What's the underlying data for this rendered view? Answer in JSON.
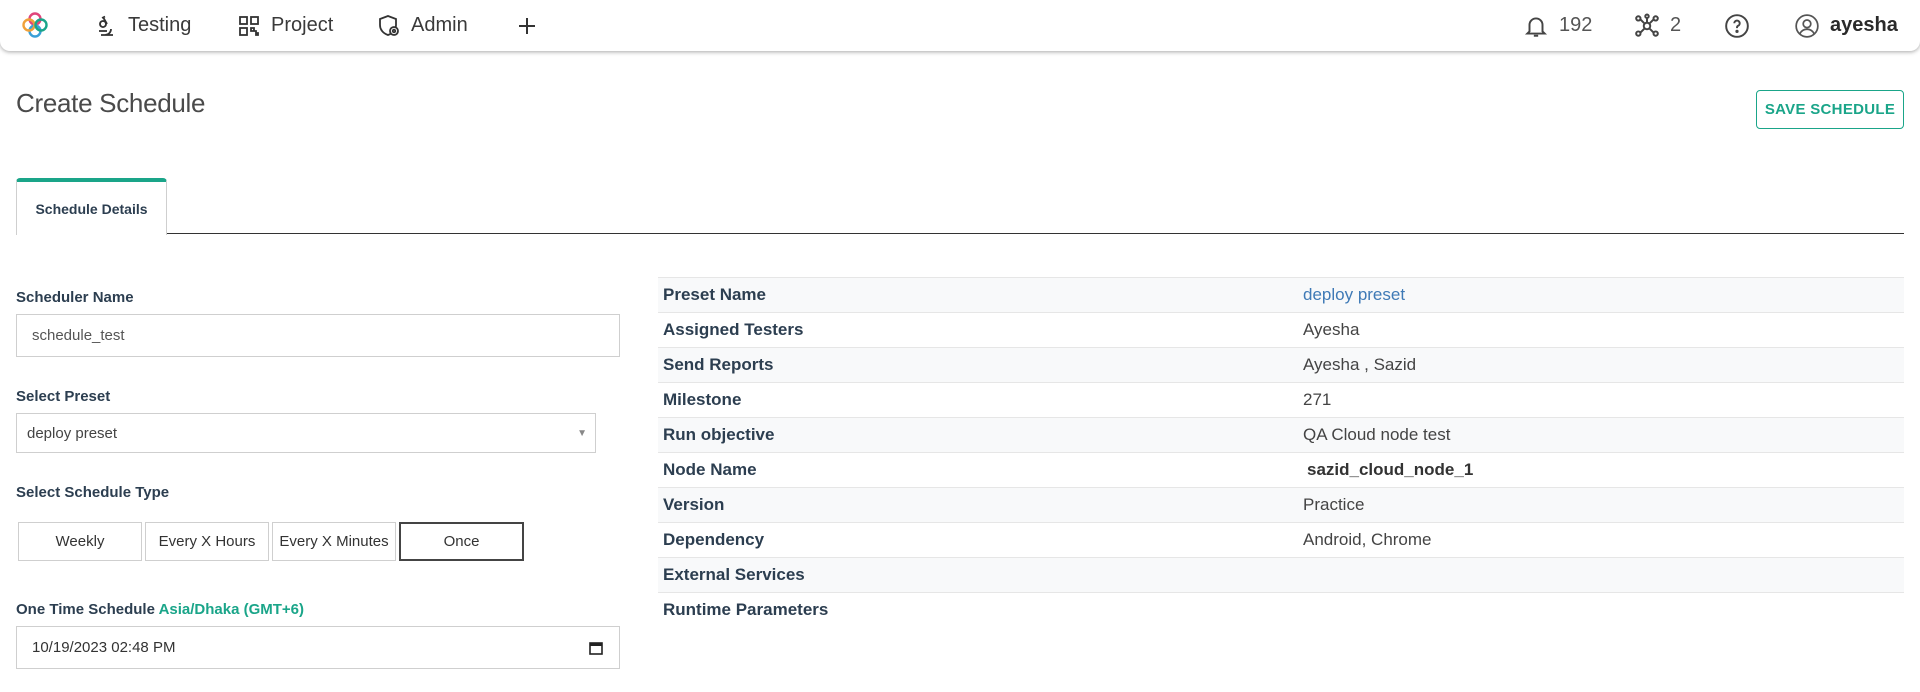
{
  "nav": {
    "items": [
      {
        "label": "Testing",
        "icon": "microscope-icon"
      },
      {
        "label": "Project",
        "icon": "qr-grid-icon"
      },
      {
        "label": "Admin",
        "icon": "shield-gear-icon"
      }
    ],
    "add_icon": "plus-icon",
    "notifications_count": "192",
    "nodes_count": "2",
    "username": "ayesha"
  },
  "page": {
    "title": "Create Schedule",
    "save_label": "SAVE SCHEDULE"
  },
  "tabs": [
    {
      "label": "Schedule Details",
      "active": true
    }
  ],
  "form": {
    "scheduler_name_label": "Scheduler Name",
    "scheduler_name_value": "schedule_test",
    "preset_label": "Select Preset",
    "preset_value": "deploy preset",
    "schedule_type_label": "Select Schedule Type",
    "schedule_types": [
      "Weekly",
      "Every X Hours",
      "Every X Minutes",
      "Once"
    ],
    "schedule_type_selected": "Once",
    "one_time_label": "One Time Schedule",
    "timezone": "Asia/Dhaka (GMT+6)",
    "datetime_value": "10/19/2023  02:48  PM"
  },
  "details": [
    {
      "key": "Preset Name",
      "value": "deploy preset"
    },
    {
      "key": "Assigned Testers",
      "value": "Ayesha"
    },
    {
      "key": "Send Reports",
      "value": "Ayesha , Sazid"
    },
    {
      "key": "Milestone",
      "value": "271"
    },
    {
      "key": "Run objective",
      "value": "QA Cloud node test"
    },
    {
      "key": "Node Name",
      "value": "sazid_cloud_node_1"
    },
    {
      "key": "Version",
      "value": "Practice"
    },
    {
      "key": "Dependency",
      "value": "Android, Chrome"
    },
    {
      "key": "External Services",
      "value": ""
    },
    {
      "key": "Runtime Parameters",
      "value": ""
    }
  ],
  "colors": {
    "accent": "#1aa589",
    "link": "#3f7ab6",
    "text": "#2c3e50"
  }
}
